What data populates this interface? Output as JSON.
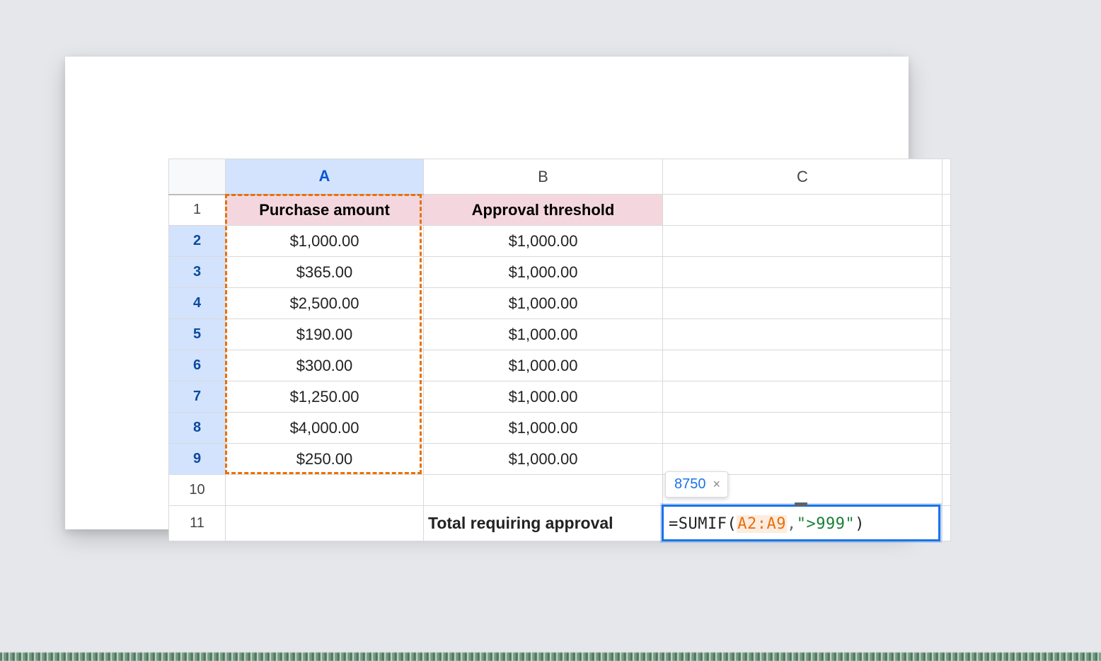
{
  "columns": {
    "a": "A",
    "b": "B",
    "c": "C"
  },
  "rows": [
    "1",
    "2",
    "3",
    "4",
    "5",
    "6",
    "7",
    "8",
    "9",
    "10",
    "11"
  ],
  "headers": {
    "a": "Purchase amount",
    "b": "Approval threshold"
  },
  "dataA": [
    "$1,000.00",
    "$365.00",
    "$2,500.00",
    "$190.00",
    "$300.00",
    "$1,250.00",
    "$4,000.00",
    "$250.00"
  ],
  "dataB": [
    "$1,000.00",
    "$1,000.00",
    "$1,000.00",
    "$1,000.00",
    "$1,000.00",
    "$1,000.00",
    "$1,000.00",
    "$1,000.00"
  ],
  "totalLabel": "Total requiring approval",
  "formula": {
    "eq": "=",
    "fn": "SUMIF",
    "open": "(",
    "range": "A2:A9",
    "comma": ",",
    "str": "\">999\"",
    "close": ")"
  },
  "resultPreview": "8750",
  "chart_data": {
    "type": "table",
    "title": "",
    "columns": [
      "Purchase amount",
      "Approval threshold"
    ],
    "rows": [
      [
        1000.0,
        1000.0
      ],
      [
        365.0,
        1000.0
      ],
      [
        2500.0,
        1000.0
      ],
      [
        190.0,
        1000.0
      ],
      [
        300.0,
        1000.0
      ],
      [
        1250.0,
        1000.0
      ],
      [
        4000.0,
        1000.0
      ],
      [
        250.0,
        1000.0
      ]
    ],
    "summary": {
      "label": "Total requiring approval",
      "formula": "=SUMIF(A2:A9,\">999\")",
      "result": 8750
    }
  }
}
